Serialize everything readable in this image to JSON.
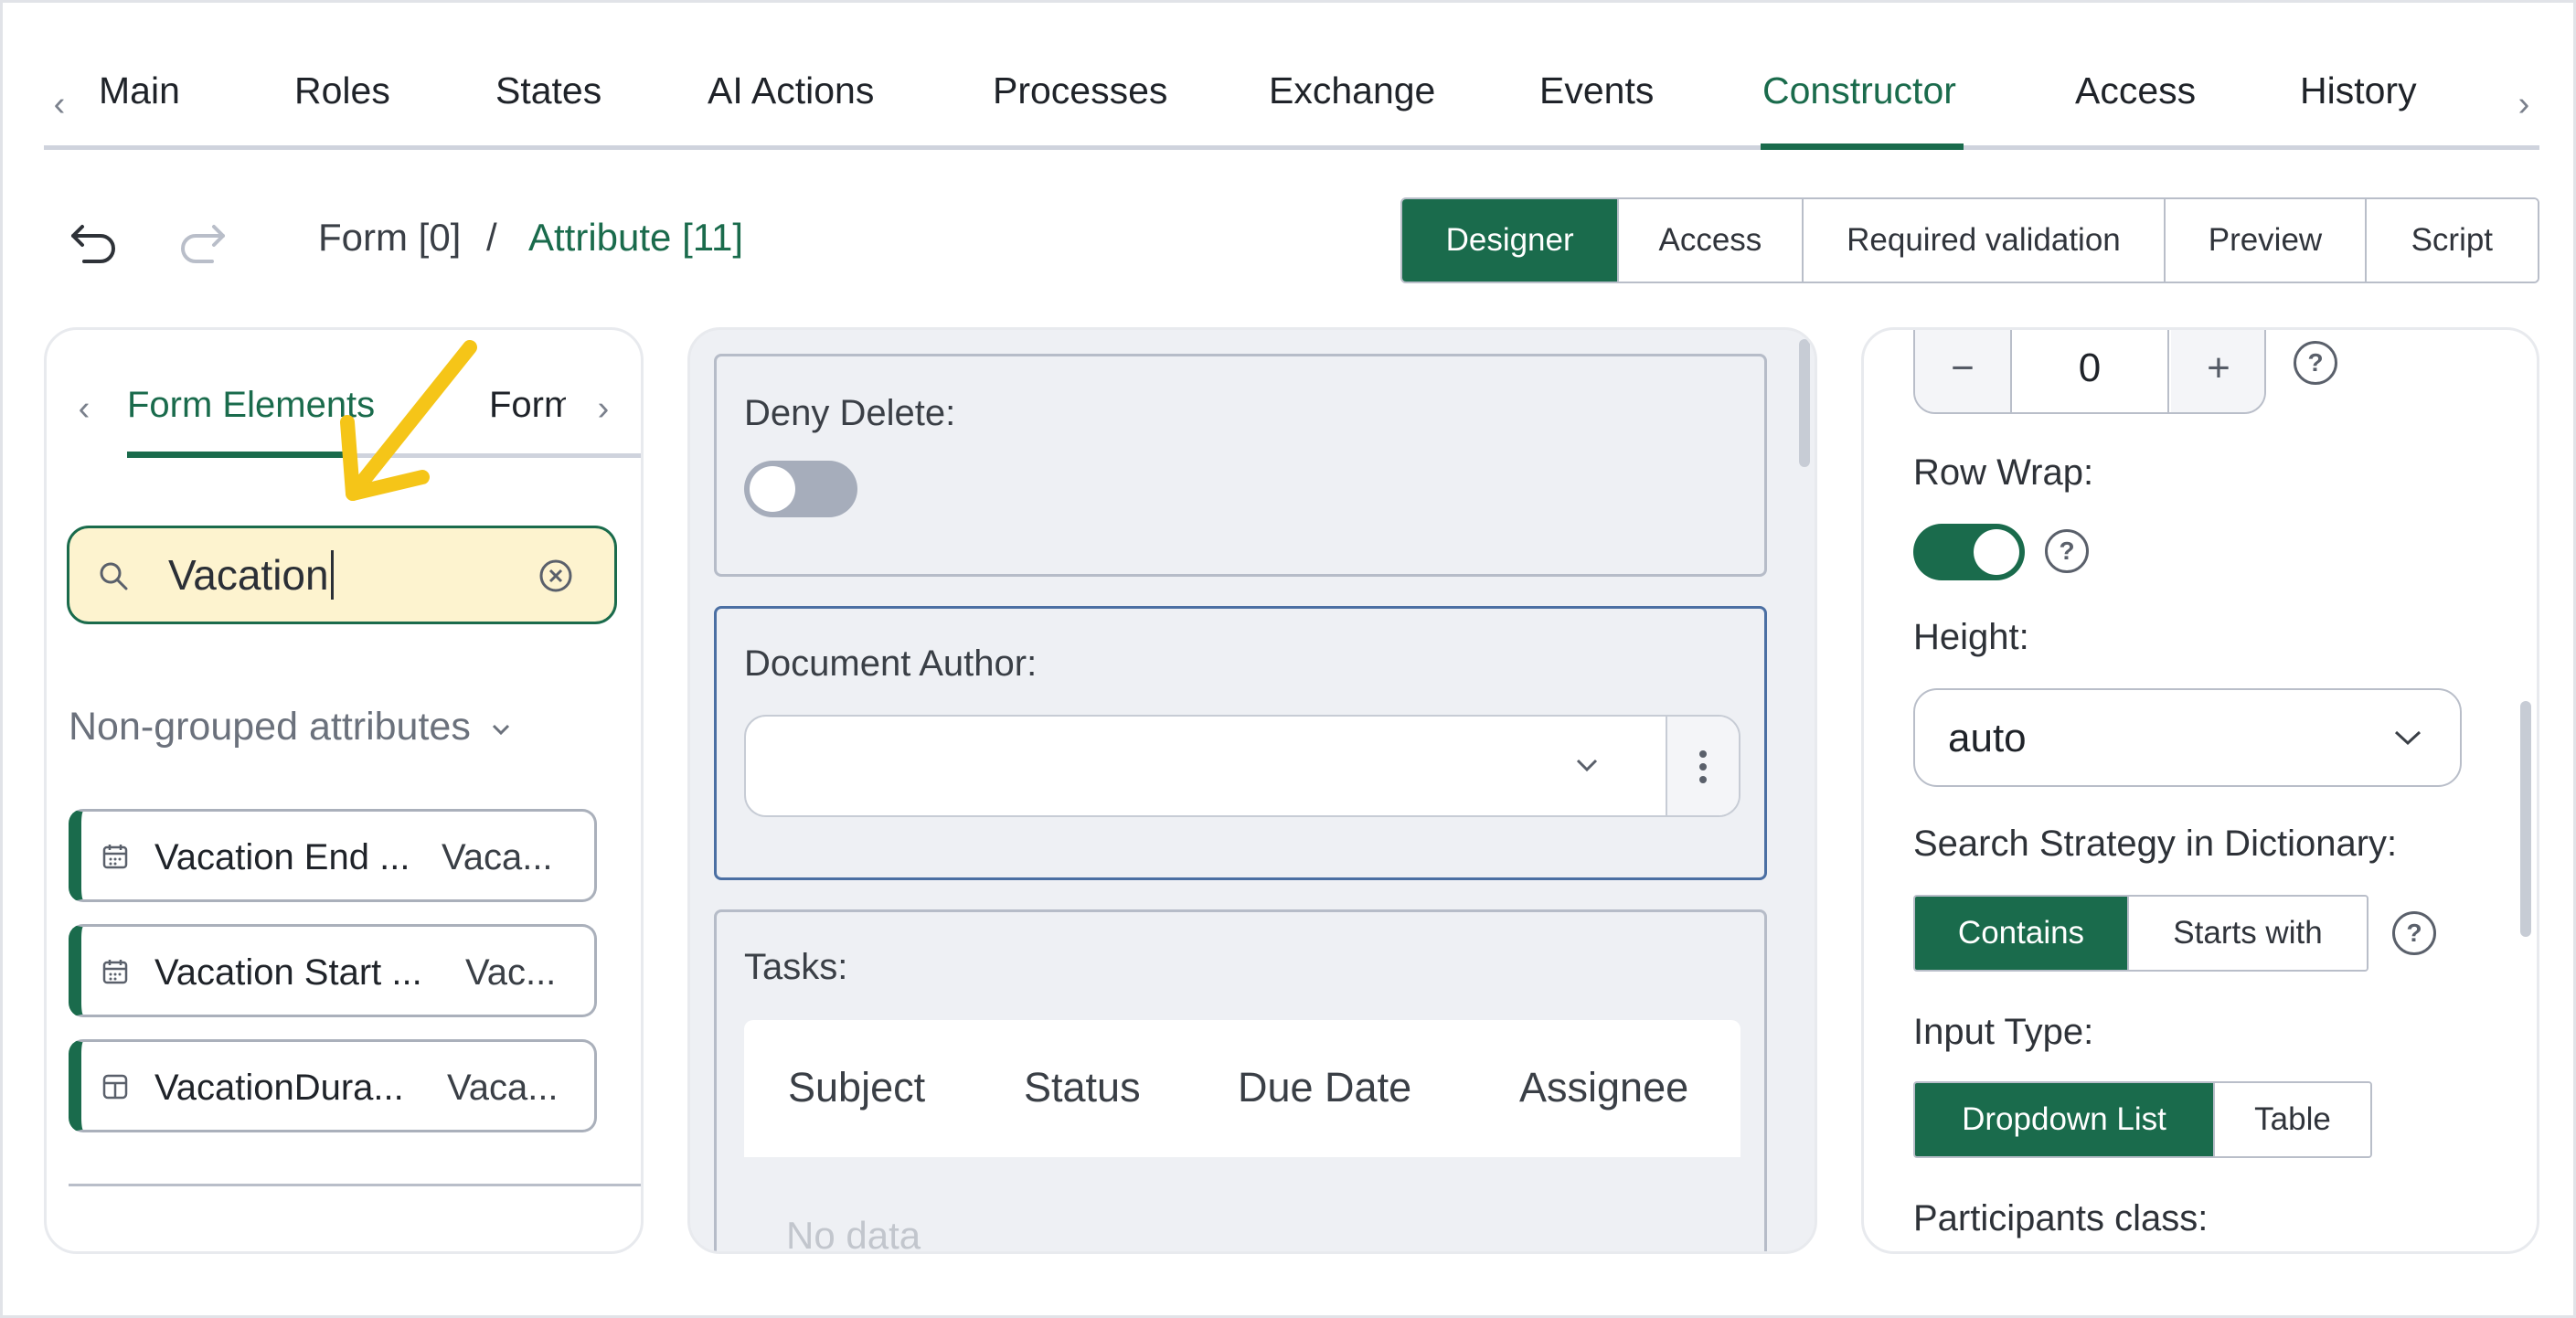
{
  "tabs": {
    "items": [
      "Main",
      "Roles",
      "States",
      "AI Actions",
      "Processes",
      "Exchange",
      "Events",
      "Constructor",
      "Access",
      "History"
    ],
    "active": "Constructor"
  },
  "breadcrumb": {
    "form": "Form [0]",
    "separator": "/",
    "attribute": "Attribute [11]"
  },
  "view_tabs": {
    "items": [
      "Designer",
      "Access",
      "Required validation",
      "Preview",
      "Script"
    ],
    "active": "Designer"
  },
  "left_panel": {
    "tab_active": "Form Elements",
    "tab_next": "Form",
    "search": {
      "value": "Vacation"
    },
    "group": "Non-grouped attributes",
    "attributes": [
      {
        "name": "Vacation End ...",
        "code": "Vaca...",
        "icon": "calendar-icon"
      },
      {
        "name": "Vacation Start ...",
        "code": "Vac...",
        "icon": "calendar-icon"
      },
      {
        "name": "VacationDura...",
        "code": "Vaca...",
        "icon": "layout-icon"
      }
    ]
  },
  "middle_panel": {
    "deny_delete": {
      "label": "Deny Delete:",
      "enabled": false
    },
    "document_author": {
      "label": "Document Author:",
      "value": ""
    },
    "tasks": {
      "label": "Tasks:",
      "columns": [
        "Subject",
        "Status",
        "Due Date",
        "Assignee"
      ],
      "empty_text": "No data"
    }
  },
  "right_panel": {
    "stepper": {
      "value": "0",
      "minus": "−",
      "plus": "+"
    },
    "row_wrap": {
      "label": "Row Wrap:",
      "enabled": true
    },
    "height": {
      "label": "Height:",
      "value": "auto"
    },
    "search_strategy": {
      "label": "Search Strategy in Dictionary:",
      "options": [
        "Contains",
        "Starts with"
      ],
      "active": "Contains"
    },
    "input_type": {
      "label": "Input Type:",
      "options": [
        "Dropdown List",
        "Table"
      ],
      "active": "Dropdown List"
    },
    "participants_class": {
      "label": "Participants class:"
    },
    "help_glyph": "?"
  },
  "colors": {
    "accent": "#1a6b4c",
    "search_highlight": "#fdf3cf",
    "annotation_arrow": "#f5c518"
  }
}
